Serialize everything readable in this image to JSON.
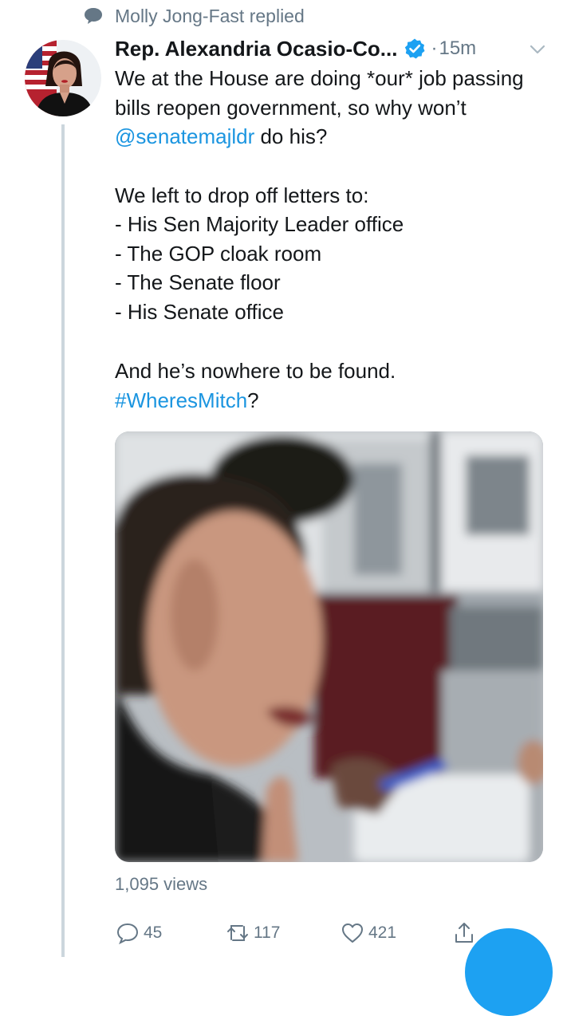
{
  "reply_context": {
    "text": "Molly Jong-Fast replied",
    "icon": "speech-bubble-icon"
  },
  "tweet": {
    "author_name": "Rep. Alexandria Ocasio-Co...",
    "verified": true,
    "separator": "·",
    "time": "15m",
    "text": {
      "p1_a": "We at the House are doing *our* job passing bills reopen government, so why won’t ",
      "p1_mention": "@senatemajldr",
      "p1_b": " do his?",
      "p2_line1": "We left to drop off letters to:",
      "p2_line2": "- His Sen Majority Leader office",
      "p2_line3": "- The GOP cloak room",
      "p2_line4": "- The Senate floor",
      "p2_line5": "- His Senate office",
      "p3_line1": "And he’s nowhere to be found.",
      "p3_hashtag": "#WheresMitch",
      "p3_suffix": "?"
    },
    "views": "1,095 views",
    "actions": {
      "reply_count": "45",
      "retweet_count": "117",
      "like_count": "421"
    }
  },
  "colors": {
    "link": "#1b95e0",
    "secondary_text": "#657786",
    "verified": "#1da1f2",
    "thread_line": "#ccd6dd"
  }
}
